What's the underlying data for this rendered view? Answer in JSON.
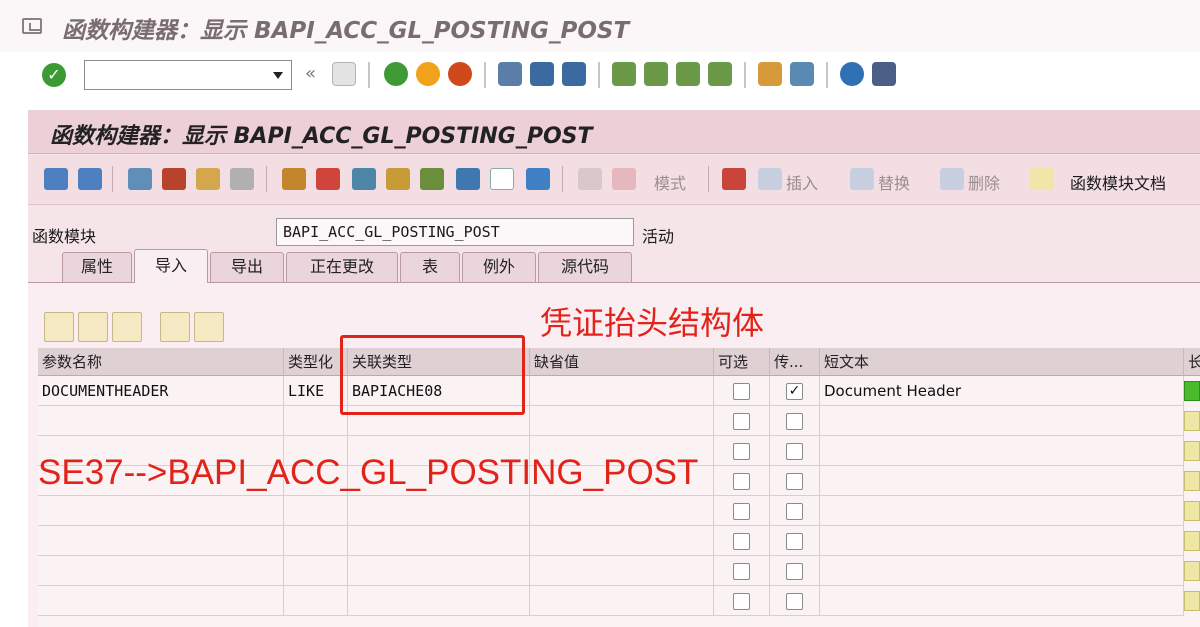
{
  "window": {
    "title": "函数构建器：显示 BAPI_ACC_GL_POSTING_POST"
  },
  "system_toolbar": {
    "command_value": "",
    "icons": [
      "enter-icon",
      "back-icon",
      "save-icon",
      "back-green-icon",
      "exit-icon",
      "cancel-icon",
      "print-icon",
      "find-icon",
      "find-next-icon",
      "first-page-icon",
      "prev-page-icon",
      "next-page-icon",
      "last-page-icon",
      "new-session-icon",
      "shortcut-icon",
      "help-icon",
      "layout-icon"
    ]
  },
  "panel": {
    "title": "函数构建器：显示 BAPI_ACC_GL_POSTING_POST"
  },
  "app_toolbar": {
    "labels": {
      "mode": "模式",
      "insert": "插入",
      "replace": "替换",
      "delete": "删除",
      "fm_doc": "函数模块文档"
    }
  },
  "function_module": {
    "label": "函数模块",
    "value": "BAPI_ACC_GL_POSTING_POST",
    "status": "活动"
  },
  "tabs": [
    {
      "label": "属性",
      "active": false
    },
    {
      "label": "导入",
      "active": true
    },
    {
      "label": "导出",
      "active": false
    },
    {
      "label": "正在更改",
      "active": false
    },
    {
      "label": "表",
      "active": false
    },
    {
      "label": "例外",
      "active": false
    },
    {
      "label": "源代码",
      "active": false
    }
  ],
  "annotation": {
    "header_note": "凭证抬头结构体",
    "path_note": "SE37-->BAPI_ACC_GL_POSTING_POST"
  },
  "table": {
    "columns": [
      "参数名称",
      "类型化",
      "关联类型",
      "缺省值",
      "可选",
      "传...",
      "短文本",
      "长"
    ],
    "rows": [
      {
        "param": "DOCUMENTHEADER",
        "typing": "LIKE",
        "assoc_type": "BAPIACHE08",
        "default": "",
        "optional": false,
        "pass_value": true,
        "short_text": "Document Header"
      }
    ],
    "empty_rows": 7
  },
  "colors": {
    "accent_red": "#e2231a",
    "panel_pink": "#f5e4e8",
    "status_green": "#4bbb2d"
  }
}
